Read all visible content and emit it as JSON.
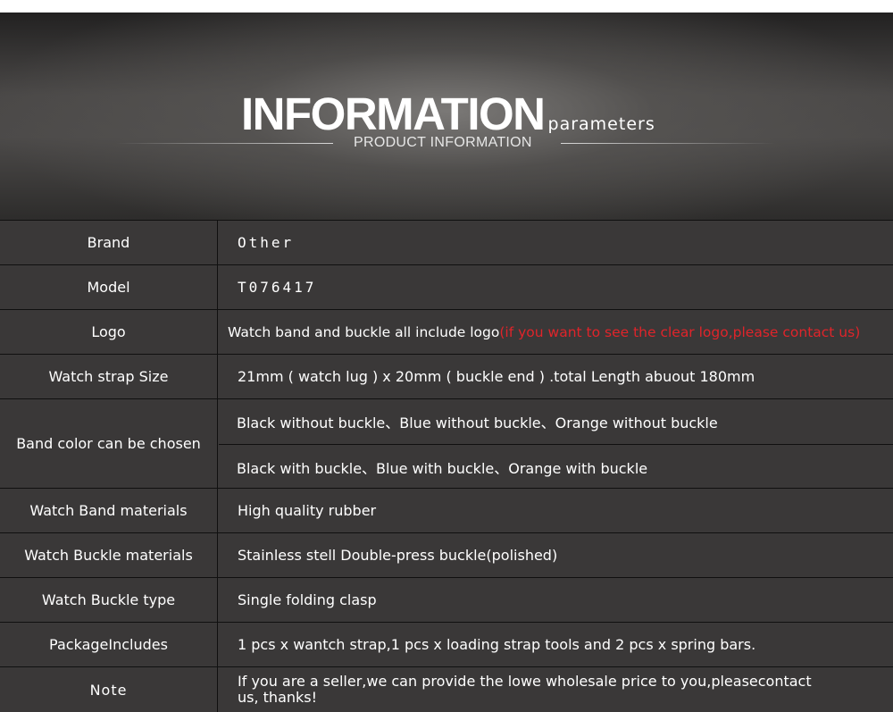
{
  "header": {
    "title_main": "INFORMATION",
    "title_suffix": "parameters",
    "subtitle": "PRODUCT  INFORMATION"
  },
  "rows": {
    "brand": {
      "label": "Brand",
      "value": "Other"
    },
    "model": {
      "label": "Model",
      "value": "T076417"
    },
    "logo": {
      "label": "Logo",
      "value": "Watch band and buckle all include logo ",
      "note": "(if you want to see the clear logo,please contact us)"
    },
    "size": {
      "label": "Watch strap Size",
      "value": "21mm ( watch lug ) x 20mm ( buckle end ) .total Length abuout 180mm"
    },
    "color": {
      "label": "Band color can be chosen",
      "option1": "Black without buckle、Blue without buckle、Orange without buckle",
      "option2": "Black with buckle、Blue with buckle、Orange with buckle"
    },
    "band_material": {
      "label": "Watch Band materials",
      "value": "High quality rubber"
    },
    "buckle_material": {
      "label": "Watch Buckle materials",
      "value": "Stainless stell Double-press buckle(polished)"
    },
    "buckle_type": {
      "label": "Watch Buckle type",
      "value": "Single folding clasp"
    },
    "package": {
      "label": "PackageIncludes",
      "value": "1 pcs x wantch strap,1 pcs x loading strap tools and 2 pcs x spring bars."
    },
    "note": {
      "label": "Note",
      "value": "If you are a seller,we can provide the lowe wholesale price to you,pleasecontact us, thanks!"
    }
  },
  "colors": {
    "background": "#3a3838",
    "divider": "#101010",
    "accent_red": "#e0242a"
  }
}
